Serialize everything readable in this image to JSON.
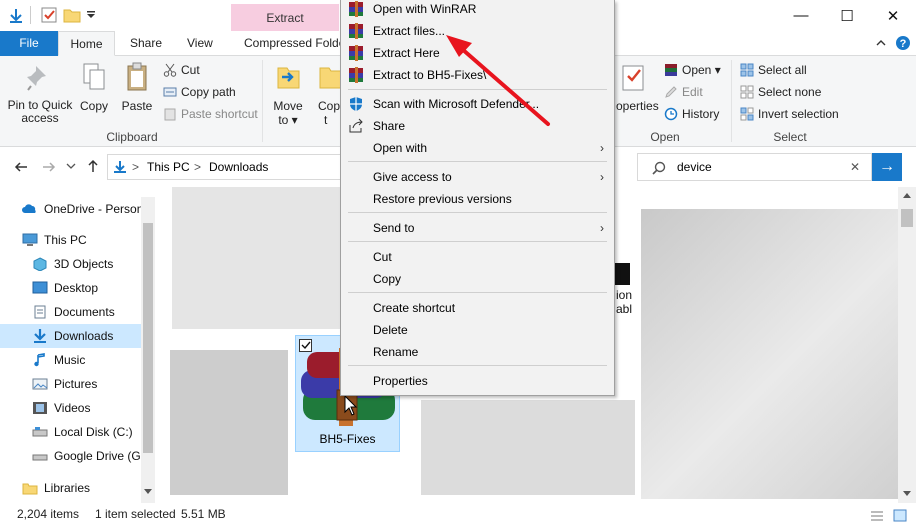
{
  "window": {
    "contextual_tab": "Extract",
    "minimize_glyph": "—",
    "maximize_glyph": "☐",
    "close_glyph": "✕"
  },
  "ribbon_tabs": {
    "file": "File",
    "home": "Home",
    "share": "Share",
    "view": "View",
    "compressed": "Compressed Folde"
  },
  "ribbon": {
    "clipboard": {
      "pin_label": "Pin to Quick access",
      "copy_label": "Copy",
      "paste_label": "Paste",
      "cut_label": "Cut",
      "copy_path_label": "Copy path",
      "paste_shortcut_label": "Paste shortcut",
      "group_label": "Clipboard"
    },
    "organize": {
      "move_label": "Move",
      "move_sub": "to ▾",
      "copy_label": "Cop",
      "copy_sub": "t"
    },
    "open": {
      "properties_label": "operties",
      "open_label": "Open ▾",
      "edit_label": "Edit",
      "history_label": "History",
      "group_label": "Open"
    },
    "select": {
      "select_all": "Select all",
      "select_none": "Select none",
      "invert": "Invert selection",
      "group_label": "Select"
    }
  },
  "address": {
    "path": [
      "This PC",
      "Downloads"
    ],
    "separator": ">"
  },
  "search": {
    "value": "device",
    "clear_glyph": "✕",
    "go_glyph": "→"
  },
  "nav": {
    "items": [
      {
        "label": "OneDrive - Person",
        "icon": "cloud-icon"
      },
      {
        "label": "This PC",
        "icon": "computer-icon"
      },
      {
        "label": "3D Objects",
        "icon": "cube-icon"
      },
      {
        "label": "Desktop",
        "icon": "desktop-icon"
      },
      {
        "label": "Documents",
        "icon": "documents-icon"
      },
      {
        "label": "Downloads",
        "icon": "download-icon"
      },
      {
        "label": "Music",
        "icon": "music-icon"
      },
      {
        "label": "Pictures",
        "icon": "pictures-icon"
      },
      {
        "label": "Videos",
        "icon": "videos-icon"
      },
      {
        "label": "Local Disk (C:)",
        "icon": "drive-icon"
      },
      {
        "label": "Google Drive (G:",
        "icon": "drive-icon"
      },
      {
        "label": "Libraries",
        "icon": "libraries-icon"
      }
    ]
  },
  "content": {
    "selected_file": "BH5-Fixes",
    "partial_label_1": "ion",
    "partial_label_2": "abl"
  },
  "status": {
    "items_count": "2,204 items",
    "selection": "1 item selected",
    "size": "5.51 MB"
  },
  "context_menu": {
    "items": [
      {
        "label": "Open with WinRAR",
        "icon": "winrar-icon"
      },
      {
        "label": "Extract files...",
        "icon": "winrar-icon"
      },
      {
        "label": "Extract Here",
        "icon": "winrar-icon"
      },
      {
        "label": "Extract to BH5-Fixes\\",
        "icon": "winrar-icon"
      },
      {
        "label": "Scan with Microsoft Defender...",
        "icon": "defender-icon"
      },
      {
        "label": "Share",
        "icon": "share-icon"
      },
      {
        "label": "Open with",
        "submenu": true
      },
      {
        "label": "Give access to",
        "submenu": true
      },
      {
        "label": "Restore previous versions"
      },
      {
        "label": "Send to",
        "submenu": true
      },
      {
        "label": "Cut"
      },
      {
        "label": "Copy"
      },
      {
        "label": "Create shortcut"
      },
      {
        "label": "Delete"
      },
      {
        "label": "Rename"
      },
      {
        "label": "Properties"
      }
    ],
    "submenu_glyph": "›"
  },
  "colors": {
    "accent": "#1979ca",
    "contextual_tab": "#f7cde0",
    "selection": "#cce8ff",
    "annotation_arrow": "#e8141e"
  }
}
